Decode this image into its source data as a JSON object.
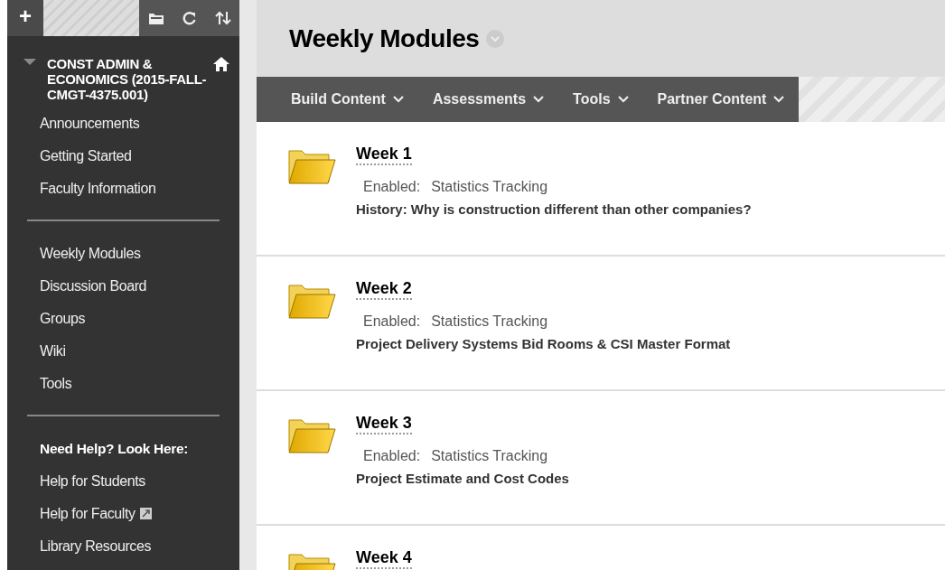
{
  "toolbar": {
    "add": "+"
  },
  "course": {
    "title": "CONST ADMIN & ECONOMICS (2015-FALL-CMGT-4375.001)",
    "expanded": true
  },
  "sidebar": {
    "items": [
      {
        "kind": "link",
        "label": "Announcements"
      },
      {
        "kind": "link",
        "label": "Getting Started"
      },
      {
        "kind": "link",
        "label": "Faculty Information"
      },
      {
        "kind": "divider"
      },
      {
        "kind": "link",
        "label": "Weekly Modules"
      },
      {
        "kind": "link",
        "label": "Discussion Board"
      },
      {
        "kind": "link",
        "label": "Groups"
      },
      {
        "kind": "link",
        "label": "Wiki"
      },
      {
        "kind": "link",
        "label": "Tools"
      },
      {
        "kind": "divider"
      },
      {
        "kind": "heading",
        "label": "Need Help? Look Here:"
      },
      {
        "kind": "link",
        "label": "Help for Students"
      },
      {
        "kind": "link",
        "label": "Help for Faculty",
        "external": true
      },
      {
        "kind": "link",
        "label": "Library Resources"
      }
    ]
  },
  "page": {
    "title": "Weekly Modules"
  },
  "menu": [
    "Build Content",
    "Assessments",
    "Tools",
    "Partner Content"
  ],
  "modules": [
    {
      "title": "Week 1",
      "enabled_label": "Enabled:",
      "enabled_value": "Statistics Tracking",
      "description": "History: Why is construction different than other companies?"
    },
    {
      "title": "Week 2",
      "enabled_label": "Enabled:",
      "enabled_value": "Statistics Tracking",
      "description": "Project Delivery Systems Bid Rooms & CSI Master Format"
    },
    {
      "title": "Week 3",
      "enabled_label": "Enabled:",
      "enabled_value": "Statistics Tracking",
      "description": "Project Estimate and Cost Codes"
    },
    {
      "title": "Week 4"
    }
  ]
}
